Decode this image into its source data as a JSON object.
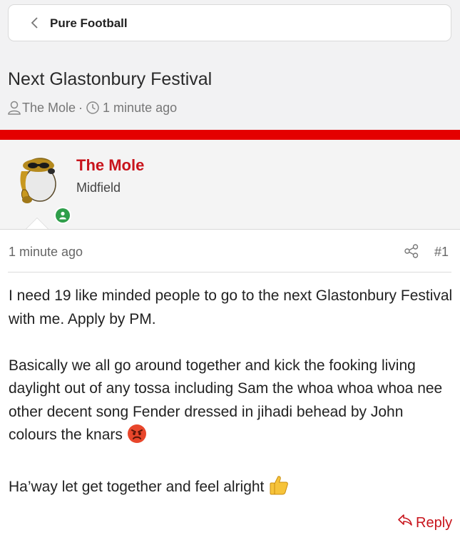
{
  "breadcrumb": {
    "back_icon": "chevron-left-icon",
    "label": "Pure Football"
  },
  "thread": {
    "title": "Next Glastonbury Festival",
    "author": "The Mole",
    "separator": "·",
    "time": "1 minute ago"
  },
  "post": {
    "author_name": "The Mole",
    "author_role": "Midfield",
    "time": "1 minute ago",
    "number": "#1",
    "paragraphs": [
      "I need 19 like minded people to go to the next Glastonbury Festival with me. Apply by PM.",
      "Basically we all go around together and kick the fooking living daylight out of any tossa including Sam the whoa whoa whoa nee other decent song Fender dressed in jihadi behead by John colours the knars",
      "Ha’way let get together and feel alright"
    ],
    "reply_label": "Reply"
  },
  "colors": {
    "accent_red": "#e40000",
    "author_name": "#c8141c",
    "online_status": "#2e9e4a"
  }
}
